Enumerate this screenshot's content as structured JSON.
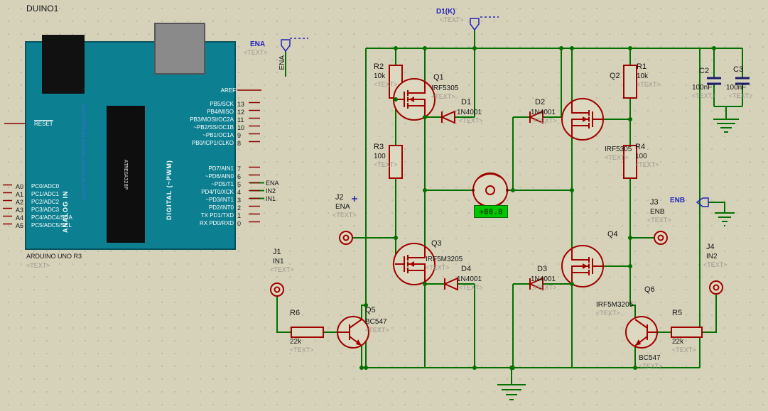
{
  "colors": {
    "gridbg": "#d6d2ba",
    "griddot": "#bdb9a1",
    "wire": "#007000",
    "pin": "#8b0000",
    "component": "#a00000",
    "compfill": "#ddd8c0",
    "netlabel": "#2222bb",
    "placeholder": "#9b978b",
    "cap": "#1c1c6e",
    "board": "#0c7f91",
    "boardborder": "#09525f",
    "jack": "#111111",
    "usb": "#8a8a8a",
    "text": "#141414",
    "displaybg": "#00c800",
    "displaytext": "#143c00",
    "watermark": "#3b6fd4"
  },
  "arduino": {
    "ref": "DUINO1",
    "part_name": "ARDUINO UNO R3",
    "text": "<TEXT>",
    "reset": "RESET",
    "aref": "AREF",
    "analog_in": "ANALOG IN",
    "digital_pwm": "DIGITAL (~PWM)",
    "watermark": "www.microcontrolandos.blogspot.com",
    "chip": "ATMEGA328P",
    "digital_pins_upper": [
      {
        "num": "13",
        "label": "PB5/SCK"
      },
      {
        "num": "12",
        "label": "PB4/MISO"
      },
      {
        "num": "11",
        "label": "PB3/MOSI/OC2A"
      },
      {
        "num": "10",
        "label": "~PB2/SS/OC1B"
      },
      {
        "num": "9",
        "label": "~PB1/OC1A"
      },
      {
        "num": "8",
        "label": "PB0/ICP1/CLKO"
      }
    ],
    "digital_pins_lower": [
      {
        "num": "7",
        "label": "PD7/AIN1"
      },
      {
        "num": "6",
        "label": "~PD6/AIN0"
      },
      {
        "num": "5",
        "label": "~PD5/T1"
      },
      {
        "num": "4",
        "label": "PD4/T0/XCK"
      },
      {
        "num": "3",
        "label": "~PD3/INT1"
      },
      {
        "num": "2",
        "label": "PD2/INT0"
      },
      {
        "num": "1",
        "label": "TX PD1/TXD"
      },
      {
        "num": "0",
        "label": "RX PD0/RXD"
      }
    ],
    "analog_pins": [
      {
        "num": "A0",
        "label": "PC0/ADC0"
      },
      {
        "num": "A1",
        "label": "PC1/ADC1"
      },
      {
        "num": "A2",
        "label": "PC2/ADC2"
      },
      {
        "num": "A3",
        "label": "PC3/ADC3"
      },
      {
        "num": "A4",
        "label": "PC4/ADC4/SDA"
      },
      {
        "num": "A5",
        "label": "PC5/ADC5/SCL"
      }
    ],
    "wire_labels": [
      {
        "label": "ENA"
      },
      {
        "label": "IN2"
      },
      {
        "label": "IN1"
      }
    ]
  },
  "terminals": {
    "ena": {
      "label": "ENA",
      "text": "<TEXT>",
      "vertical_label": "ENA"
    },
    "d1k": {
      "label": "D1(K)",
      "text": "<TEXT>"
    },
    "enb": {
      "label": "ENB"
    }
  },
  "components": {
    "R1": {
      "ref": "R1",
      "value": "10k",
      "text": "<TEXT>"
    },
    "R2": {
      "ref": "R2",
      "value": "10k",
      "text": "<TEXT>"
    },
    "R3": {
      "ref": "R3",
      "value": "100",
      "text": "<TEXT>"
    },
    "R4": {
      "ref": "R4",
      "value": "100",
      "text": "<TEXT>"
    },
    "R5": {
      "ref": "R5",
      "value": "22k",
      "text": "<TEXT>"
    },
    "R6": {
      "ref": "R6",
      "value": "22k",
      "text": "<TEXT>"
    },
    "C2": {
      "ref": "C2",
      "value": "100nF",
      "text": "<TEXT>"
    },
    "C3": {
      "ref": "C3",
      "value": "100nF",
      "text": "<TEXT>"
    },
    "D1": {
      "ref": "D1",
      "value": "1N4001",
      "text": "<TEXT>"
    },
    "D2": {
      "ref": "D2",
      "value": "1N4001",
      "text": "<TEXT>"
    },
    "D3": {
      "ref": "D3",
      "value": "1N4001",
      "text": "<TEXT>"
    },
    "D4": {
      "ref": "D4",
      "value": "1N4001",
      "text": "<TEXT>"
    },
    "Q1": {
      "ref": "Q1",
      "value": "IRF5305",
      "text": "<TEXT>"
    },
    "Q2": {
      "ref": "Q2",
      "value": "IRF5305",
      "text": "<TEXT>"
    },
    "Q3": {
      "ref": "Q3",
      "value": "IRF5M3205",
      "text": "<TEXT>"
    },
    "Q4": {
      "ref": "Q4",
      "value": "IRF5M3205",
      "text": "<TEXT>"
    },
    "Q5": {
      "ref": "Q5",
      "value": "BC547",
      "text": "<TEXT>"
    },
    "Q6": {
      "ref": "Q6",
      "value": "BC547",
      "text": "<TEXT>"
    },
    "J1": {
      "ref": "J1",
      "value": "IN1",
      "text": "<TEXT>"
    },
    "J2": {
      "ref": "J2",
      "value": "ENA",
      "text": "<TEXT>"
    },
    "J3": {
      "ref": "J3",
      "value": "ENB",
      "text": "<TEXT>"
    },
    "J4": {
      "ref": "J4",
      "value": "IN2",
      "text": "<TEXT>"
    }
  },
  "motor": {
    "display": "+88.8"
  }
}
